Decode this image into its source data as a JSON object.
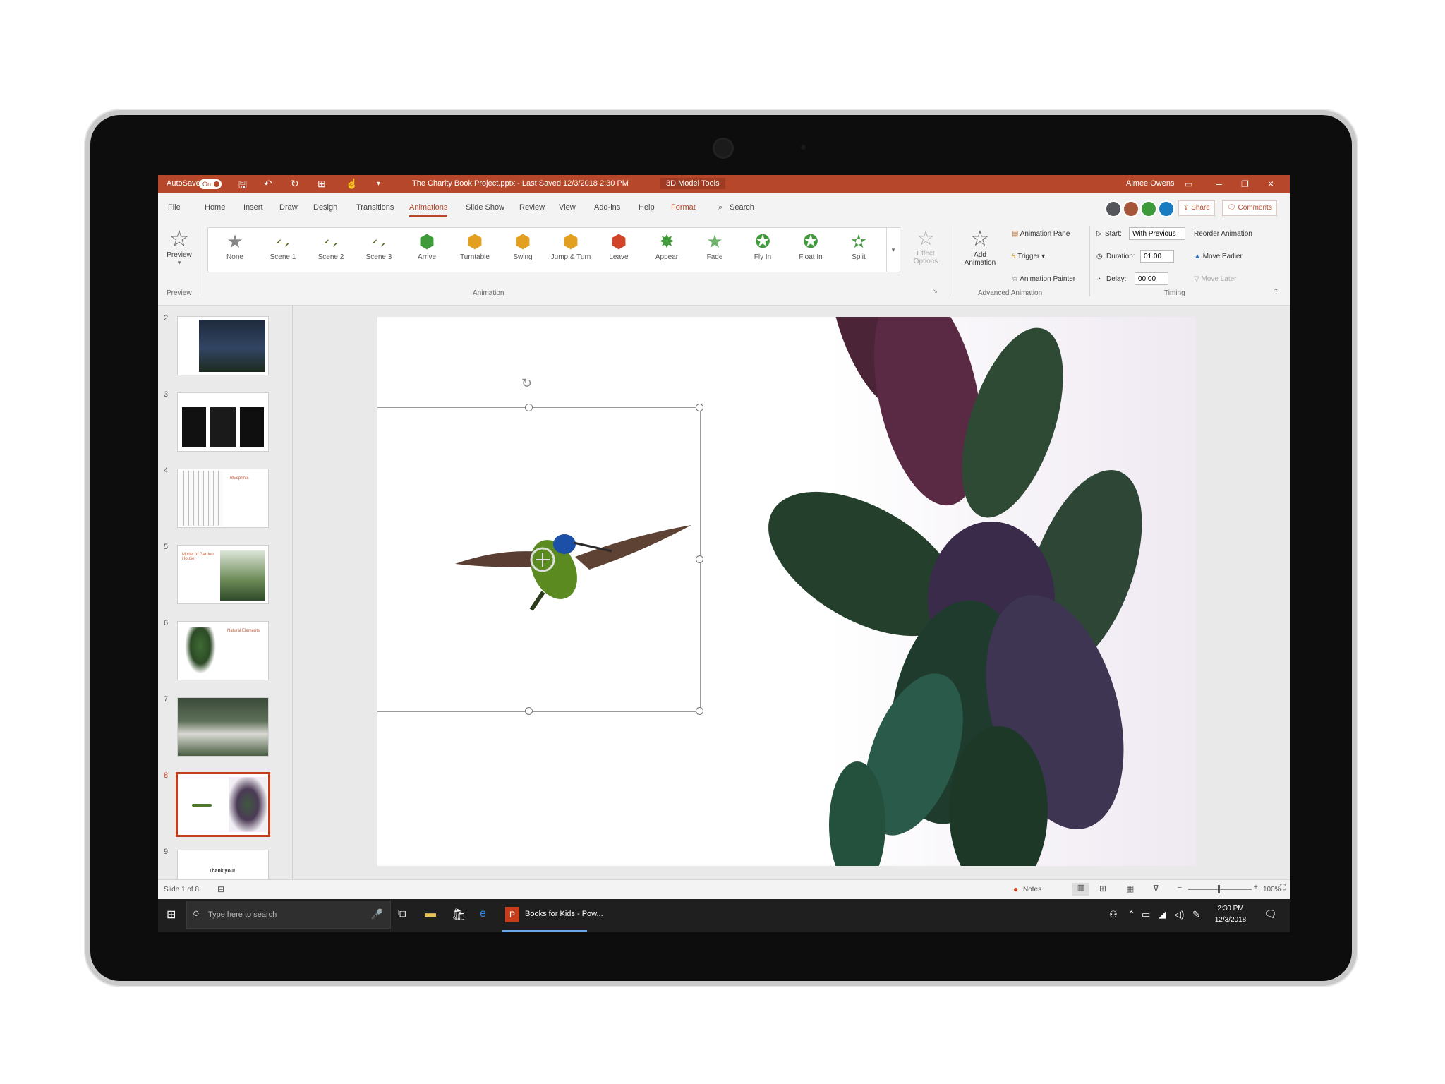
{
  "titlebar": {
    "autosave_label": "AutoSave",
    "autosave_state": "On",
    "document_title": "The Charity Book Project.pptx - Last Saved 12/3/2018 2:30 PM",
    "context_tab": "3D Model Tools",
    "user_name": "Aimee Owens",
    "accent_color": "#b7472a"
  },
  "tabs": [
    "File",
    "Home",
    "Insert",
    "Draw",
    "Design",
    "Transitions",
    "Animations",
    "Slide Show",
    "Review",
    "View",
    "Add-ins",
    "Help",
    "Format"
  ],
  "active_tab": "Animations",
  "search_label": "Search",
  "share_label": "Share",
  "comments_label": "Comments",
  "ribbon": {
    "preview_label": "Preview",
    "preview_group": "Preview",
    "animation_group": "Animation",
    "animations": [
      {
        "label": "None",
        "icon": "star-outline-icon"
      },
      {
        "label": "Scene 1",
        "icon": "bird-icon"
      },
      {
        "label": "Scene 2",
        "icon": "bird-icon"
      },
      {
        "label": "Scene 3",
        "icon": "bird-icon"
      },
      {
        "label": "Arrive",
        "icon": "cube-arrive-icon"
      },
      {
        "label": "Turntable",
        "icon": "cube-turntable-icon"
      },
      {
        "label": "Swing",
        "icon": "cube-swing-icon"
      },
      {
        "label": "Jump & Turn",
        "icon": "cube-jump-icon"
      },
      {
        "label": "Leave",
        "icon": "cube-leave-icon"
      },
      {
        "label": "Appear",
        "icon": "star-appear-icon"
      },
      {
        "label": "Fade",
        "icon": "star-fade-icon"
      },
      {
        "label": "Fly In",
        "icon": "star-fly-icon"
      },
      {
        "label": "Float In",
        "icon": "star-float-icon"
      },
      {
        "label": "Split",
        "icon": "star-split-icon"
      }
    ],
    "effect_options_line1": "Effect",
    "effect_options_line2": "Options",
    "add_animation_line1": "Add",
    "add_animation_line2": "Animation",
    "animation_pane": "Animation Pane",
    "trigger": "Trigger",
    "animation_painter": "Animation Painter",
    "advanced_group": "Advanced Animation",
    "start_label": "Start:",
    "start_value": "With Previous",
    "duration_label": "Duration:",
    "duration_value": "01.00",
    "delay_label": "Delay:",
    "delay_value": "00.00",
    "reorder_label": "Reorder Animation",
    "move_earlier": "Move Earlier",
    "move_later": "Move Later",
    "timing_group": "Timing"
  },
  "slides": [
    {
      "number": "2"
    },
    {
      "number": "3"
    },
    {
      "number": "4",
      "text": "Blueprints"
    },
    {
      "number": "5",
      "text": "Model of Garden House"
    },
    {
      "number": "6",
      "text": "Natural Elements"
    },
    {
      "number": "7"
    },
    {
      "number": "8"
    },
    {
      "number": "9",
      "text": "Thank you!"
    }
  ],
  "selected_slide": "8",
  "status": {
    "slide_counter": "Slide 1 of 8",
    "notes": "Notes",
    "zoom": "100%"
  },
  "taskbar": {
    "search_placeholder": "Type here to search",
    "app_label": "Books for Kids - Pow...",
    "time": "2:30 PM",
    "date": "12/3/2018"
  }
}
